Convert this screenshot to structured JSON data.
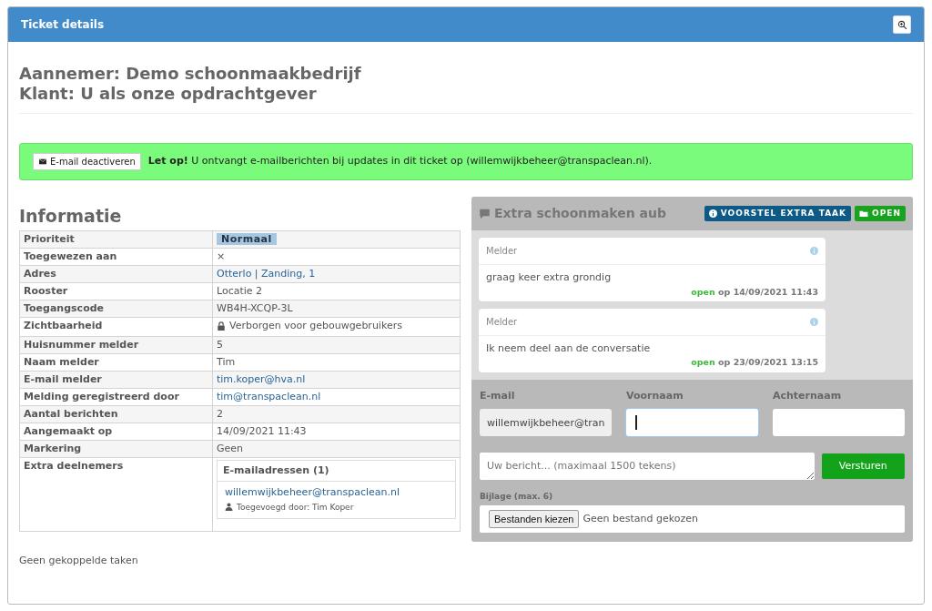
{
  "window": {
    "title": "Ticket details"
  },
  "heading": {
    "contractor": "Aannemer: Demo schoonmaakbedrijf",
    "client": "Klant: U als onze opdrachtgever"
  },
  "alert": {
    "button": "E-mail deactiveren",
    "message": "**Let op!** U ontvangt e-mailberichten bij updates in dit ticket op (willemwijkbeheer@transpaclean.nl)."
  },
  "info": {
    "title": "Informatie",
    "rows": [
      {
        "label": "Prioriteit",
        "kind": "badge",
        "value": "Normaal"
      },
      {
        "label": "Toegewezen aan",
        "kind": "text",
        "value": "×"
      },
      {
        "label": "Adres",
        "kind": "link",
        "value": "Otterlo | Zanding, 1"
      },
      {
        "label": "Rooster",
        "kind": "text",
        "value": "Locatie 2"
      },
      {
        "label": "Toegangscode",
        "kind": "text",
        "value": "WB4H-XCQP-3L"
      },
      {
        "label": "Zichtbaarheid",
        "kind": "locked",
        "value": "Verborgen voor gebouwgebruikers"
      },
      {
        "label": "Huisnummer melder",
        "kind": "text",
        "value": "5"
      },
      {
        "label": "Naam melder",
        "kind": "text",
        "value": "Tim"
      },
      {
        "label": "E-mail melder",
        "kind": "link",
        "value": "tim.koper@hva.nl"
      },
      {
        "label": "Melding geregistreerd door",
        "kind": "link",
        "value": "tim@transpaclean.nl"
      },
      {
        "label": "Aantal berichten",
        "kind": "text",
        "value": "2"
      },
      {
        "label": "Aangemaakt op",
        "kind": "text",
        "value": "14/09/2021 11:43"
      },
      {
        "label": "Markering",
        "kind": "text",
        "value": "Geen"
      },
      {
        "label": "Extra deelnemers",
        "kind": "participants",
        "title": "E-mailadressen (1)",
        "email": "willemwijkbeheer@transpaclean.nl",
        "added_by": "Toegevoegd door: Tim Koper"
      }
    ],
    "footer": "Geen gekoppelde taken"
  },
  "conversation": {
    "title": "Extra schoonmaken aub",
    "tags": [
      {
        "kind": "info",
        "label": "VOORSTEL EXTRA TAAK"
      },
      {
        "kind": "folder",
        "label": "OPEN"
      }
    ],
    "messages": [
      {
        "author": "Melder",
        "text": "graag keer extra grondig",
        "status": "open",
        "date": "op 14/09/2021 11:43"
      },
      {
        "author": "Melder",
        "text": "Ik neem deel aan de conversatie",
        "status": "open",
        "date": "op 23/09/2021 13:15"
      }
    ],
    "form": {
      "fields": [
        {
          "label": "E-mail",
          "value": "willemwijkbeheer@tran",
          "readonly": true,
          "focused": false
        },
        {
          "label": "Voornaam",
          "readonly": false,
          "focused": true
        },
        {
          "label": "Achternaam",
          "readonly": false,
          "focused": false
        }
      ],
      "message_placeholder": "Uw bericht... (maximaal 1500 tekens)",
      "send": "Versturen",
      "attachment_label": "Bijlage (max. 6)",
      "file_button": "Bestanden kiezen",
      "file_status": "Geen bestand gekozen"
    }
  }
}
